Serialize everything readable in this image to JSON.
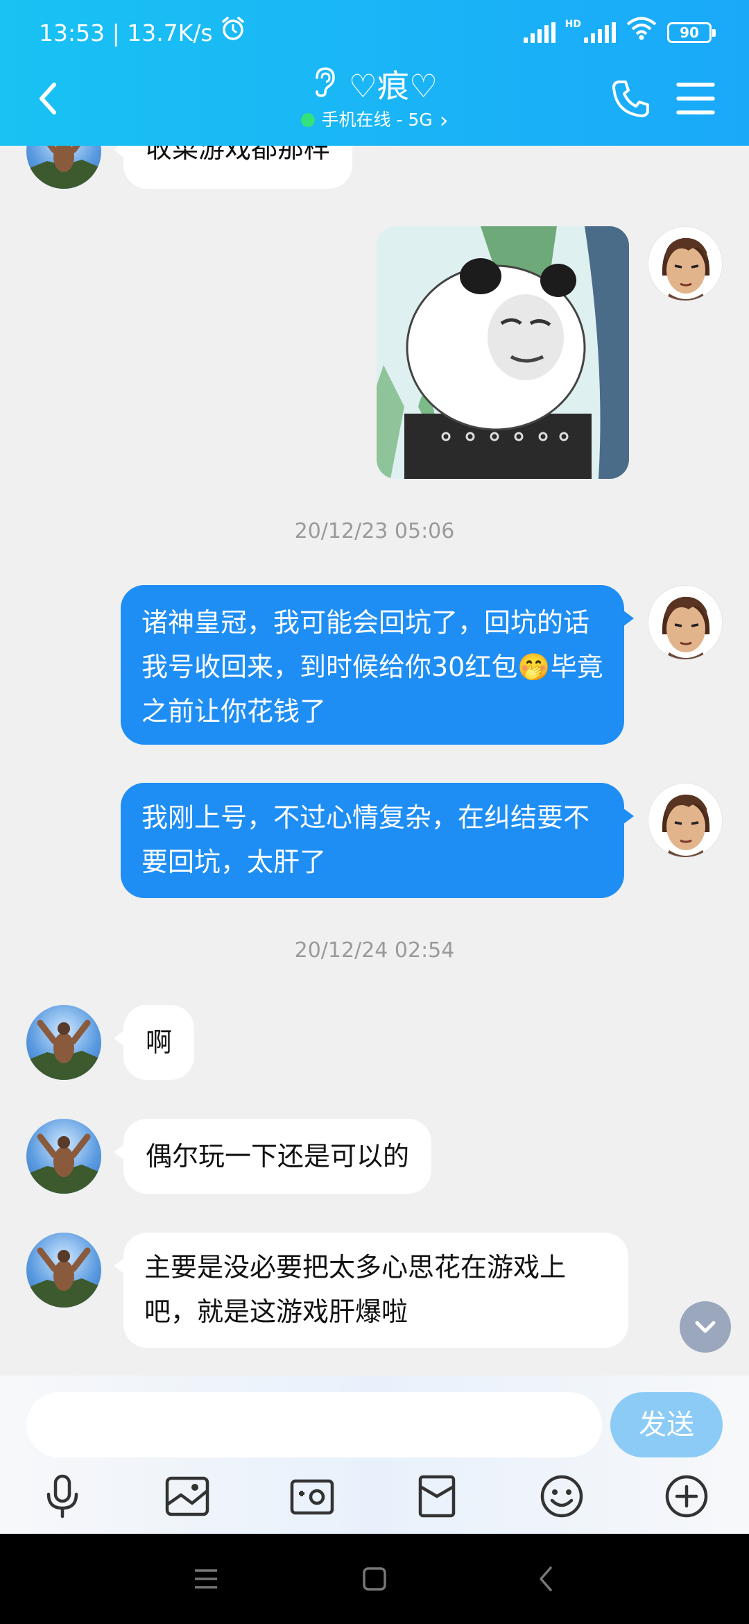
{
  "status_bar": {
    "time_speed": "13:53 | 13.7K/s",
    "hd_label": "HD",
    "battery": "90",
    "icons": [
      "alarm-icon",
      "signal-icon",
      "signal-hd-icon",
      "wifi-icon",
      "battery-icon"
    ]
  },
  "header": {
    "title": "♡痕♡",
    "subtitle": "手机在线 - 5G",
    "subtitle_arrow": "›",
    "icons": [
      "back-icon",
      "ear-icon",
      "phone-icon",
      "menu-icon"
    ]
  },
  "chat": {
    "top_cut_message": "收菜游戏都那样",
    "timestamps": [
      "20/12/23 05:06",
      "20/12/24 02:54"
    ],
    "out_message_1": {
      "part1": "诸神皇冠，我可能会回坑了，回坑的话我号收回来，到时候给你30红包",
      "emoji": "🤭",
      "part2": "毕竟之前让你花钱了"
    },
    "out_message_2": "我刚上号，不过心情复杂，在纠结要不要回坑，太肝了",
    "in_message_1": "啊",
    "in_message_2": "偶尔玩一下还是可以的",
    "in_message_3": "主要是没必要把太多心思花在游戏上吧，就是这游戏肝爆啦"
  },
  "input": {
    "placeholder": "",
    "value": "",
    "send_label": "发送"
  },
  "toolbar": [
    "mic-icon",
    "image-icon",
    "camera-icon",
    "red-packet-icon",
    "emoji-icon",
    "plus-icon"
  ],
  "colors": {
    "header_start": "#19c2f3",
    "header_end": "#1aa9f9",
    "outgoing_bubble": "#1e8ef5",
    "send_button": "#8ccbf6",
    "online_dot": "#36e07a"
  }
}
